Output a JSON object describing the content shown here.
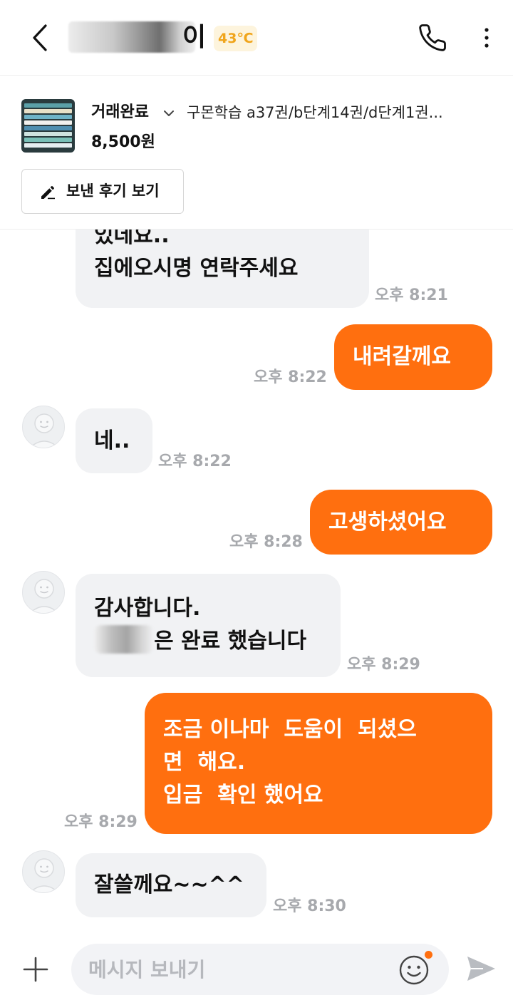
{
  "header": {
    "name_visible_suffix": "이",
    "temperature": "43℃"
  },
  "product": {
    "status": "거래완료",
    "title": "구몬학습 a37권/b단계14권/d단계1권...",
    "price": "8,500원",
    "review_button": "보낸 후기 보기"
  },
  "messages": [
    {
      "side": "in",
      "lines": [
        "있데요..",
        "집에오시명 연락주세요"
      ],
      "time": "오후 8:21"
    },
    {
      "side": "out",
      "lines": [
        "내려갈께요"
      ],
      "time": "오후 8:22"
    },
    {
      "side": "in",
      "lines": [
        "네.."
      ],
      "time": "오후 8:22"
    },
    {
      "side": "out",
      "lines": [
        "고생하셨어요"
      ],
      "time": "오후 8:28"
    },
    {
      "side": "in",
      "lines": [
        "감사합니다.",
        "은 완료 했습니다"
      ],
      "time": "오후 8:29"
    },
    {
      "side": "out",
      "lines": [
        "조금 이나마  도움이  되셨으",
        "면  해요.",
        "입금  확인 했어요"
      ],
      "time": "오후 8:29"
    },
    {
      "side": "in",
      "lines": [
        "잘쓸께요~~^^"
      ],
      "time": "오후 8:30"
    }
  ],
  "composer": {
    "placeholder": "메시지 보내기"
  },
  "colors": {
    "accent": "#ff6f0f",
    "incoming_bubble": "#f1f2f4",
    "temperature_text": "#f0a51c",
    "timestamp": "#a7a9ad"
  },
  "icons": [
    "back-arrow-icon",
    "phone-icon",
    "more-vertical-icon",
    "chevron-down-icon",
    "pencil-icon",
    "avatar-icon",
    "plus-icon",
    "emoji-icon",
    "send-icon"
  ]
}
